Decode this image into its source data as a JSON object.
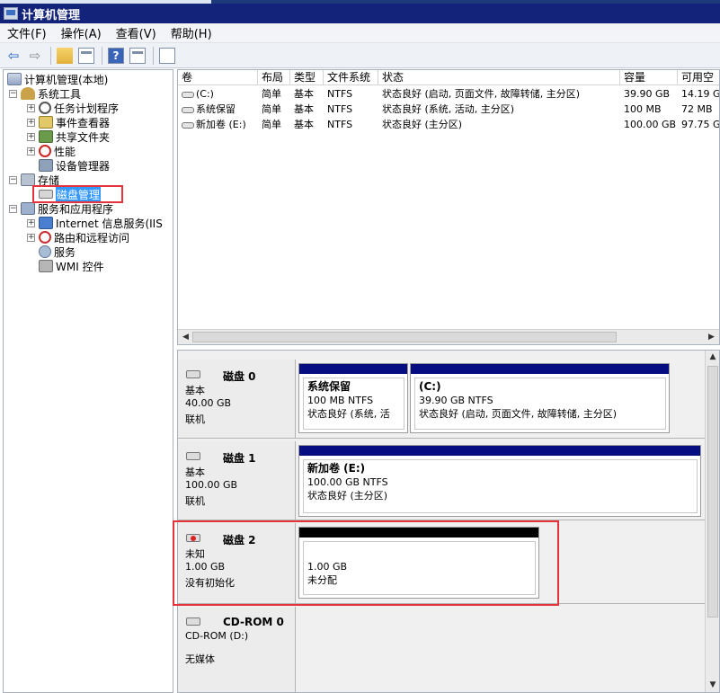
{
  "window": {
    "title": "计算机管理"
  },
  "menu": [
    "文件(F)",
    "操作(A)",
    "查看(V)",
    "帮助(H)"
  ],
  "toolbar": {
    "icons": [
      "back-arrow-icon",
      "forward-arrow-icon",
      "up-folder-icon",
      "show-hide-tree-icon",
      "help-icon",
      "properties-icon",
      "export-icon"
    ],
    "help_glyph": "?"
  },
  "tree": {
    "root": "计算机管理(本地)",
    "system_tools": "系统工具",
    "task_scheduler": "任务计划程序",
    "event_viewer": "事件查看器",
    "shared_folders": "共享文件夹",
    "performance": "性能",
    "device_manager": "设备管理器",
    "storage": "存储",
    "disk_management": "磁盘管理",
    "services_apps": "服务和应用程序",
    "iis": "Internet 信息服务(IIS",
    "routing": "路由和远程访问",
    "services": "服务",
    "wmi": "WMI 控件",
    "expanded_glyph": "−",
    "collapsed_glyph": "+"
  },
  "volume_list": {
    "columns": [
      "卷",
      "布局",
      "类型",
      "文件系统",
      "状态",
      "容量",
      "可用空"
    ],
    "rows": [
      {
        "volume": "(C:)",
        "layout": "简单",
        "type": "基本",
        "fs": "NTFS",
        "status": "状态良好 (启动, 页面文件, 故障转储, 主分区)",
        "capacity": "39.90 GB",
        "free": "14.19 G"
      },
      {
        "volume": "系统保留",
        "layout": "简单",
        "type": "基本",
        "fs": "NTFS",
        "status": "状态良好 (系统, 活动, 主分区)",
        "capacity": "100 MB",
        "free": "72 MB"
      },
      {
        "volume": "新加卷 (E:)",
        "layout": "简单",
        "type": "基本",
        "fs": "NTFS",
        "status": "状态良好 (主分区)",
        "capacity": "100.00 GB",
        "free": "97.75 G"
      }
    ],
    "scroll_left": "◀",
    "scroll_right": "▶"
  },
  "disks": [
    {
      "name": "磁盘 0",
      "kind": "基本",
      "size": "40.00 GB",
      "state": "联机",
      "partitions": [
        {
          "title": "系统保留",
          "size_fs": "100 MB NTFS",
          "status": "状态良好 (系统, 活"
        },
        {
          "title": "(C:)",
          "size_fs": "39.90 GB NTFS",
          "status": "状态良好 (启动, 页面文件, 故障转储, 主分区)"
        }
      ]
    },
    {
      "name": "磁盘 1",
      "kind": "基本",
      "size": "100.00 GB",
      "state": "联机",
      "partitions": [
        {
          "title": "新加卷 (E:)",
          "size_fs": "100.00 GB NTFS",
          "status": "状态良好 (主分区)"
        }
      ]
    },
    {
      "name": "磁盘 2",
      "kind": "未知",
      "size": "1.00 GB",
      "state": "没有初始化",
      "partitions": [
        {
          "size": "1.00 GB",
          "status": "未分配"
        }
      ]
    },
    {
      "name": "CD-ROM 0",
      "kind": "CD-ROM (D:)",
      "state": "无媒体"
    }
  ],
  "vscroll": {
    "up": "▲",
    "down": "▼"
  },
  "colors": {
    "title_bar": "#13237a",
    "partition_cap": "#050d80",
    "unallocated_cap": "#000000",
    "highlight_box": "#e6333b",
    "selection": "#3399ff"
  }
}
